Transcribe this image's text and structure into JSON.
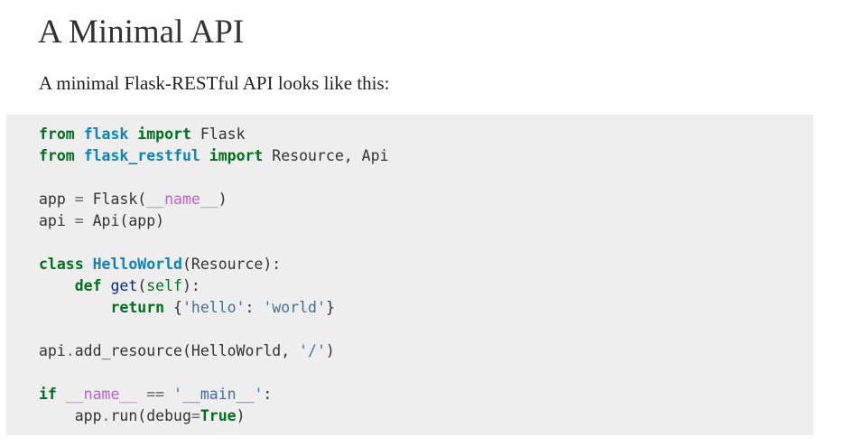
{
  "heading": "A Minimal API",
  "intro": "A minimal Flask-RESTful API looks like this:",
  "colors": {
    "keyword": "#007020",
    "module": "#0e84b5",
    "dunder": "#bb60d5",
    "string": "#4070a0",
    "code_background": "#eeeeee"
  },
  "code": {
    "lines": [
      [
        {
          "t": "from",
          "c": "kw"
        },
        {
          "t": " ",
          "c": "plain"
        },
        {
          "t": "flask",
          "c": "nn"
        },
        {
          "t": " ",
          "c": "plain"
        },
        {
          "t": "import",
          "c": "kw"
        },
        {
          "t": " Flask",
          "c": "plain"
        }
      ],
      [
        {
          "t": "from",
          "c": "kw"
        },
        {
          "t": " ",
          "c": "plain"
        },
        {
          "t": "flask_restful",
          "c": "nn"
        },
        {
          "t": " ",
          "c": "plain"
        },
        {
          "t": "import",
          "c": "kw"
        },
        {
          "t": " Resource, Api",
          "c": "plain"
        }
      ],
      [],
      [
        {
          "t": "app ",
          "c": "plain"
        },
        {
          "t": "=",
          "c": "op"
        },
        {
          "t": " Flask(",
          "c": "plain"
        },
        {
          "t": "__name__",
          "c": "dunder"
        },
        {
          "t": ")",
          "c": "plain"
        }
      ],
      [
        {
          "t": "api ",
          "c": "plain"
        },
        {
          "t": "=",
          "c": "op"
        },
        {
          "t": " Api(app)",
          "c": "plain"
        }
      ],
      [],
      [
        {
          "t": "class",
          "c": "kw"
        },
        {
          "t": " ",
          "c": "plain"
        },
        {
          "t": "HelloWorld",
          "c": "nc"
        },
        {
          "t": "(Resource):",
          "c": "plain"
        }
      ],
      [
        {
          "t": "    ",
          "c": "plain"
        },
        {
          "t": "def",
          "c": "kw"
        },
        {
          "t": " ",
          "c": "plain"
        },
        {
          "t": "get",
          "c": "nf"
        },
        {
          "t": "(",
          "c": "plain"
        },
        {
          "t": "self",
          "c": "bp"
        },
        {
          "t": "):",
          "c": "plain"
        }
      ],
      [
        {
          "t": "        ",
          "c": "plain"
        },
        {
          "t": "return",
          "c": "kw"
        },
        {
          "t": " {",
          "c": "plain"
        },
        {
          "t": "'hello'",
          "c": "str"
        },
        {
          "t": ": ",
          "c": "plain"
        },
        {
          "t": "'world'",
          "c": "str"
        },
        {
          "t": "}",
          "c": "plain"
        }
      ],
      [],
      [
        {
          "t": "api",
          "c": "plain"
        },
        {
          "t": ".",
          "c": "op"
        },
        {
          "t": "add_resource(HelloWorld, ",
          "c": "plain"
        },
        {
          "t": "'/'",
          "c": "str"
        },
        {
          "t": ")",
          "c": "plain"
        }
      ],
      [],
      [
        {
          "t": "if",
          "c": "kw"
        },
        {
          "t": " ",
          "c": "plain"
        },
        {
          "t": "__name__",
          "c": "dunder"
        },
        {
          "t": " ",
          "c": "plain"
        },
        {
          "t": "==",
          "c": "op"
        },
        {
          "t": " ",
          "c": "plain"
        },
        {
          "t": "'__main__'",
          "c": "str"
        },
        {
          "t": ":",
          "c": "plain"
        }
      ],
      [
        {
          "t": "    app",
          "c": "plain"
        },
        {
          "t": ".",
          "c": "op"
        },
        {
          "t": "run(debug",
          "c": "plain"
        },
        {
          "t": "=",
          "c": "op"
        },
        {
          "t": "True",
          "c": "kc"
        },
        {
          "t": ")",
          "c": "plain"
        }
      ]
    ]
  }
}
